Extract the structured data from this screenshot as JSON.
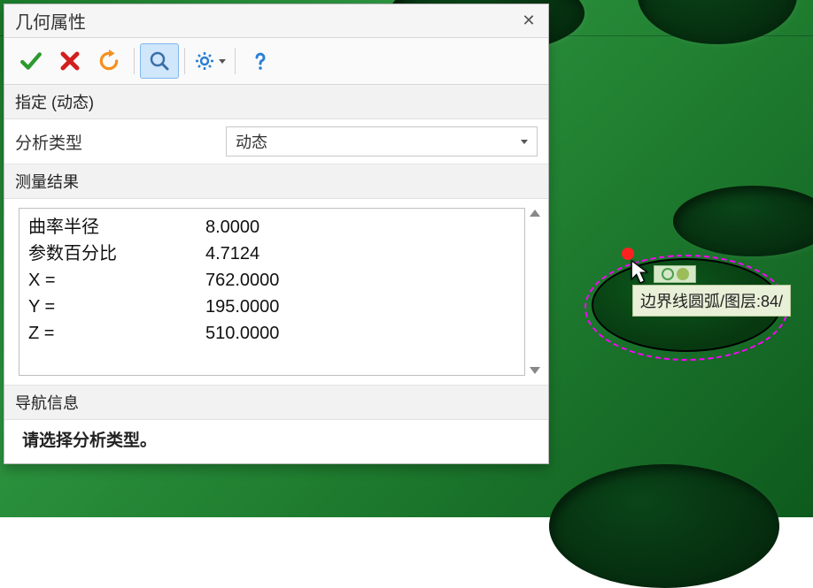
{
  "dialog": {
    "title": "几何属性",
    "section_specify": "指定 (动态)",
    "analysis_type_label": "分析类型",
    "analysis_type_value": "动态",
    "results_header": "测量结果",
    "nav_header": "导航信息",
    "nav_message": "请选择分析类型。"
  },
  "results": [
    {
      "label": "曲率半径",
      "value": "8.0000"
    },
    {
      "label": "参数百分比",
      "value": "4.7124"
    },
    {
      "label": "X =",
      "value": "762.0000"
    },
    {
      "label": "Y =",
      "value": "195.0000"
    },
    {
      "label": "Z =",
      "value": "510.0000"
    }
  ],
  "tooltip": "边界线圆弧/图层:84/",
  "icons": {
    "ok": "ok-icon",
    "cancel": "cancel-icon",
    "undo": "undo-icon",
    "zoom": "zoom-icon",
    "settings": "settings-icon",
    "help": "help-icon",
    "close": "close-icon"
  }
}
